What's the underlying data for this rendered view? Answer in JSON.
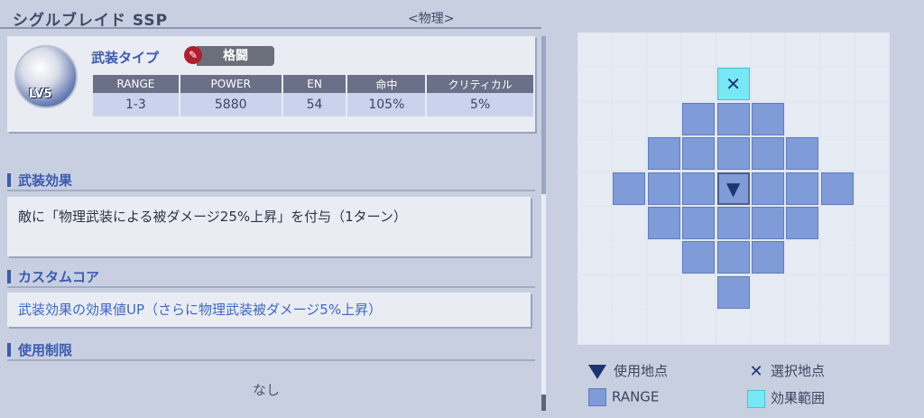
{
  "header": {
    "title": "シグルブレイド SSP",
    "subtitle": "<物理>"
  },
  "weapon": {
    "type_label": "武装タイプ",
    "type_value": "格闘",
    "level": "LV5",
    "stats_headers": [
      "RANGE",
      "POWER",
      "EN",
      "命中",
      "クリティカル"
    ],
    "stats_values": [
      "1-3",
      "5880",
      "54",
      "105%",
      "5%"
    ]
  },
  "sections": {
    "effect_title": "武装効果",
    "effect_text": "敵に「物理武装による被ダメージ25%上昇」を付与（1ターン）",
    "custom_title": "カスタムコア",
    "custom_text": "武装効果の効果値UP（さらに物理武装被ダメージ5%上昇）",
    "restrict_title": "使用制限",
    "restrict_value": "なし"
  },
  "legend": {
    "use_point": "使用地点",
    "select_point": "選択地点",
    "range": "RANGE",
    "effect_range": "効果範囲"
  },
  "colors": {
    "range": "#7f9cd8",
    "effect": "#78e8f4",
    "accent": "#3b5bb0"
  }
}
